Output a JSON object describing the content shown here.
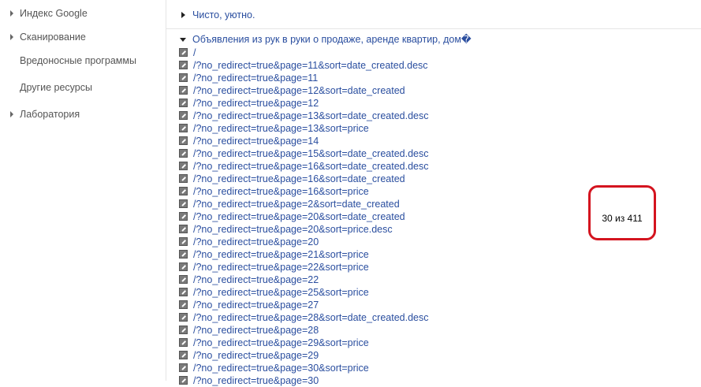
{
  "sidebar": {
    "items": [
      {
        "label": "Индекс Google",
        "has_arrow": true
      },
      {
        "label": "Сканирование",
        "has_arrow": true
      },
      {
        "label": "Вредоносные программы",
        "has_arrow": false
      },
      {
        "label": "Другие ресурсы",
        "has_arrow": false
      },
      {
        "label": "Лаборатория",
        "has_arrow": true
      }
    ]
  },
  "sections": {
    "clean": {
      "label": "Чисто, уютно.",
      "expanded": false
    },
    "ads": {
      "label": "Объявления из рук в руки о продаже, аренде квартир, дом�",
      "expanded": true
    }
  },
  "urls": [
    "/",
    "/?no_redirect=true&page=11&sort=date_created.desc",
    "/?no_redirect=true&page=11",
    "/?no_redirect=true&page=12&sort=date_created",
    "/?no_redirect=true&page=12",
    "/?no_redirect=true&page=13&sort=date_created.desc",
    "/?no_redirect=true&page=13&sort=price",
    "/?no_redirect=true&page=14",
    "/?no_redirect=true&page=15&sort=date_created.desc",
    "/?no_redirect=true&page=16&sort=date_created.desc",
    "/?no_redirect=true&page=16&sort=date_created",
    "/?no_redirect=true&page=16&sort=price",
    "/?no_redirect=true&page=2&sort=date_created",
    "/?no_redirect=true&page=20&sort=date_created",
    "/?no_redirect=true&page=20&sort=price.desc",
    "/?no_redirect=true&page=20",
    "/?no_redirect=true&page=21&sort=price",
    "/?no_redirect=true&page=22&sort=price",
    "/?no_redirect=true&page=22",
    "/?no_redirect=true&page=25&sort=price",
    "/?no_redirect=true&page=27",
    "/?no_redirect=true&page=28&sort=date_created.desc",
    "/?no_redirect=true&page=28",
    "/?no_redirect=true&page=29&sort=price",
    "/?no_redirect=true&page=29",
    "/?no_redirect=true&page=30&sort=price",
    "/?no_redirect=true&page=30"
  ],
  "callout": {
    "text": "30 из 411",
    "border_color": "#d4141f"
  },
  "colors": {
    "link": "#2a4e9f",
    "nav_text": "#555555",
    "divider": "#e5e5e5"
  }
}
